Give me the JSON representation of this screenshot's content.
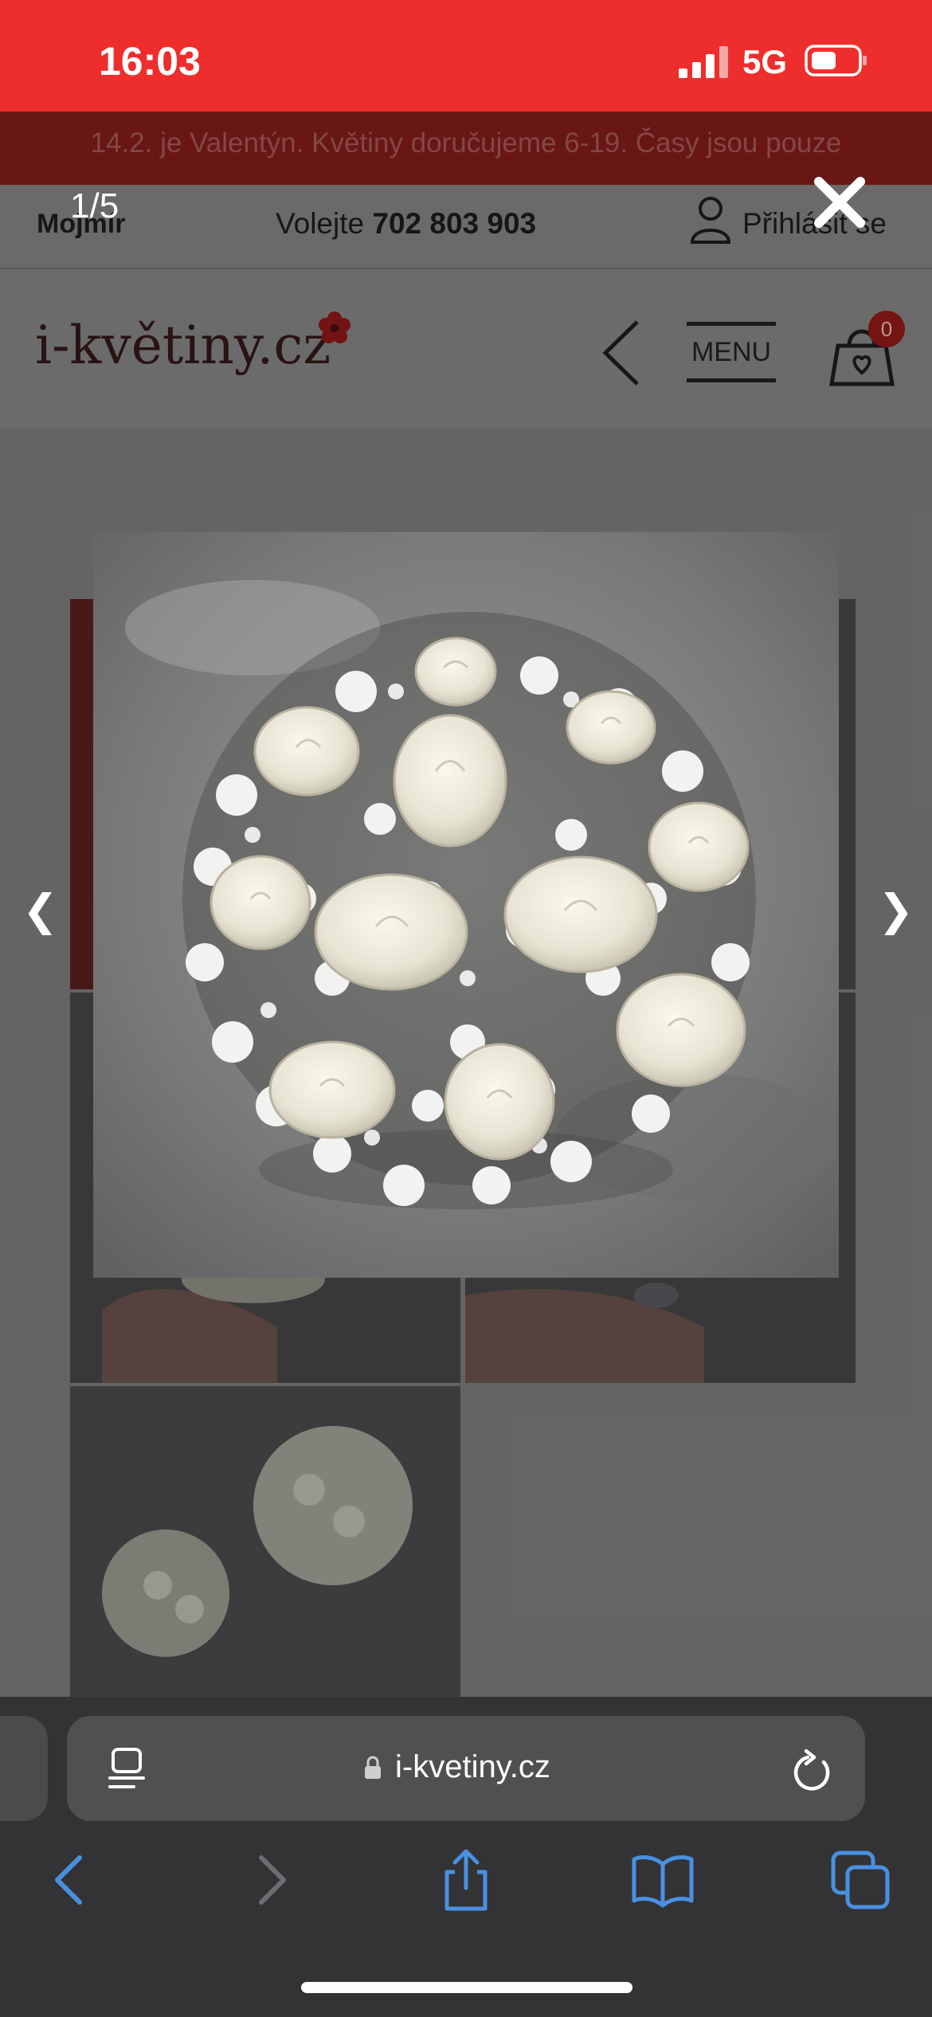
{
  "status_bar": {
    "time": "16:03",
    "network": "5G"
  },
  "site": {
    "banner_text": "14.2. je Valentýn. Květiny doručujeme 6-19. Časy jsou pouze",
    "topbar_left": "Mojmír",
    "call_prefix": "Volejte",
    "call_number": "702 803 903",
    "login_label": "Přihlásit se",
    "logo_text": "i-květiny.cz",
    "menu_label": "MENU",
    "cart_count": "0"
  },
  "lightbox": {
    "counter": "1/5",
    "prev_glyph": "❮",
    "next_glyph": "❯"
  },
  "browser": {
    "url": "i-kvetiny.cz"
  },
  "colors": {
    "status_bar": "#ee2e2c",
    "browser_accent": "#4a90e2"
  }
}
